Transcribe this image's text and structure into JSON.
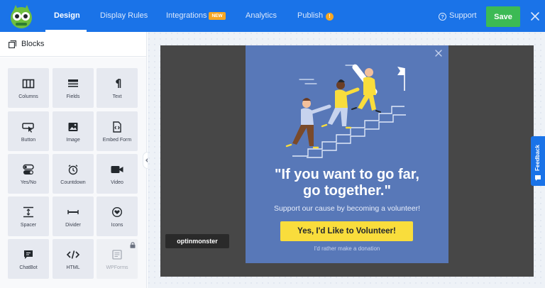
{
  "nav": {
    "tabs": [
      {
        "label": "Design",
        "active": true
      },
      {
        "label": "Display Rules"
      },
      {
        "label": "Integrations",
        "badge": "NEW"
      },
      {
        "label": "Analytics"
      },
      {
        "label": "Publish",
        "badge_icon": "warning-icon"
      }
    ],
    "support_label": "Support",
    "save_label": "Save",
    "icons": {
      "logo": "optinmonster-logo",
      "close": "close-icon",
      "support": "help-circle-icon"
    }
  },
  "sidebar": {
    "title": "Blocks",
    "blocks": [
      {
        "label": "Columns",
        "icon": "columns-icon"
      },
      {
        "label": "Fields",
        "icon": "fields-icon"
      },
      {
        "label": "Text",
        "icon": "paragraph-icon"
      },
      {
        "label": "Button",
        "icon": "button-cursor-icon"
      },
      {
        "label": "Image",
        "icon": "image-icon"
      },
      {
        "label": "Embed Form",
        "icon": "code-file-icon"
      },
      {
        "label": "Yes/No",
        "icon": "toggle-icon"
      },
      {
        "label": "Countdown",
        "icon": "alarm-clock-icon"
      },
      {
        "label": "Video",
        "icon": "video-camera-icon"
      },
      {
        "label": "Spacer",
        "icon": "spacer-icon"
      },
      {
        "label": "Divider",
        "icon": "divider-icon"
      },
      {
        "label": "Icons",
        "icon": "heart-circle-icon"
      },
      {
        "label": "ChatBot",
        "icon": "chat-icon"
      },
      {
        "label": "HTML",
        "icon": "code-brackets-icon"
      },
      {
        "label": "WPForms",
        "icon": "wpforms-icon",
        "locked": true
      }
    ]
  },
  "canvas": {
    "brand_label": "optinmonster",
    "popup": {
      "headline_line1": "\"If you want to go far,",
      "headline_line2": "go together.\"",
      "subtext": "Support our cause by becoming a volunteer!",
      "cta_label": "Yes, I'd Like to Volunteer!",
      "decline_label": "I'd rather make a donation"
    }
  },
  "feedback_label": "Feedback",
  "colors": {
    "nav_bg": "#1a73e8",
    "save_green": "#3cba54",
    "popup_bg": "#5878b8",
    "cta_yellow": "#f9dd3c",
    "badge_orange": "#f5a623"
  }
}
